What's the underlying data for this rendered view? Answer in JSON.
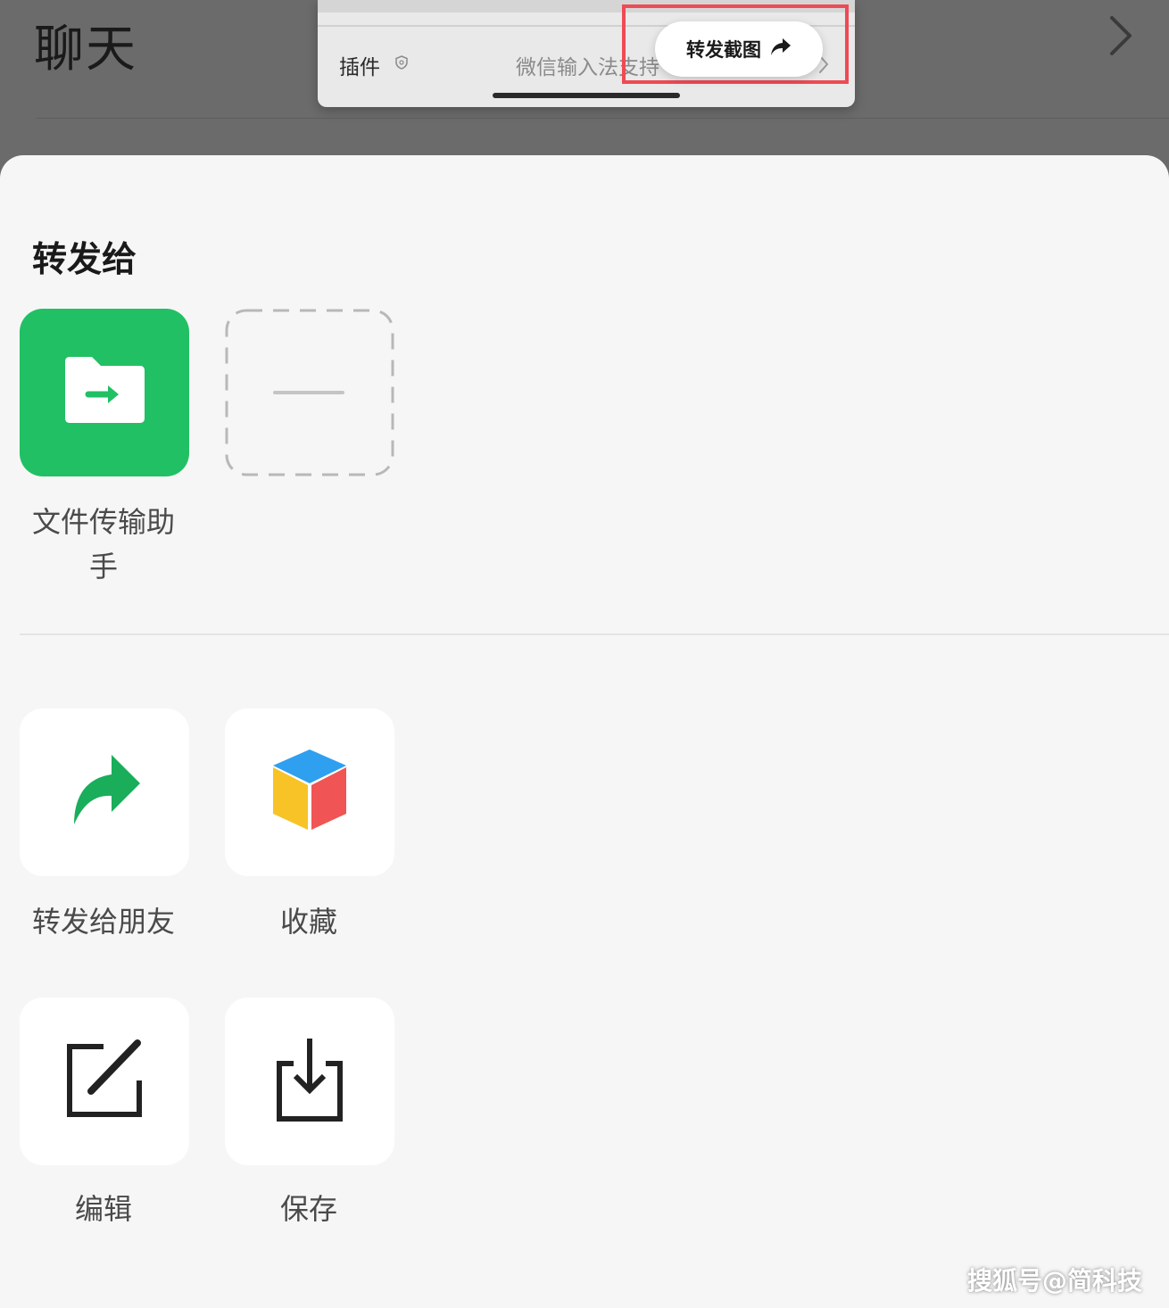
{
  "background": {
    "title": "聊天"
  },
  "preview": {
    "plugin_label": "插件",
    "desc_text": "微信输入法支持"
  },
  "floating_button": {
    "label": "转发截图"
  },
  "sheet": {
    "title": "转发给",
    "recipients": [
      {
        "label": "文件传输助手",
        "icon": "folder-forward-icon",
        "color": "#21c064"
      },
      {
        "label": "",
        "icon": "add-placeholder-icon"
      }
    ],
    "actions": [
      {
        "label": "转发给朋友",
        "icon": "forward-arrow-icon",
        "color": "#1aad5a"
      },
      {
        "label": "收藏",
        "icon": "favorites-cube-icon"
      },
      {
        "label": "编辑",
        "icon": "edit-icon"
      },
      {
        "label": "保存",
        "icon": "save-download-icon"
      }
    ]
  },
  "watermark": "搜狐号@简科技",
  "colors": {
    "highlight": "#ee4a55",
    "green": "#21c064",
    "dim_overlay": "#6b6b6b",
    "sheet_bg": "#f6f6f6"
  }
}
